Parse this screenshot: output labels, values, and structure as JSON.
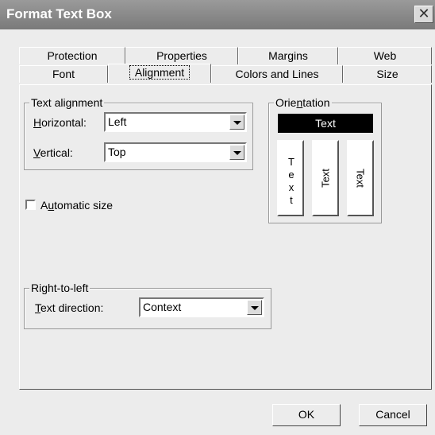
{
  "window": {
    "title": "Format Text Box",
    "close_glyph": "✕"
  },
  "tabs": {
    "row_back": [
      "Protection",
      "Properties",
      "Margins",
      "Web"
    ],
    "row_front": [
      "Font",
      "Alignment",
      "Colors and Lines",
      "Size"
    ],
    "active": "Alignment"
  },
  "text_alignment": {
    "legend": "Text alignment",
    "horizontal_label": "Horizontal:",
    "horizontal_value": "Left",
    "vertical_label": "Vertical:",
    "vertical_value": "Top"
  },
  "orientation": {
    "legend": "Orientation",
    "horizontal_text": "Text",
    "stacked_letters": [
      "T",
      "e",
      "x",
      "t"
    ],
    "rotated_down_text": "Text",
    "rotated_up_text": "Text"
  },
  "automatic_size": {
    "label": "Automatic size",
    "checked": false
  },
  "rtl": {
    "legend": "Right-to-left",
    "direction_label": "Text direction:",
    "direction_value": "Context"
  },
  "buttons": {
    "ok": "OK",
    "cancel": "Cancel"
  },
  "icons": {
    "dropdown": "chevron-down-icon",
    "close": "close-icon"
  }
}
